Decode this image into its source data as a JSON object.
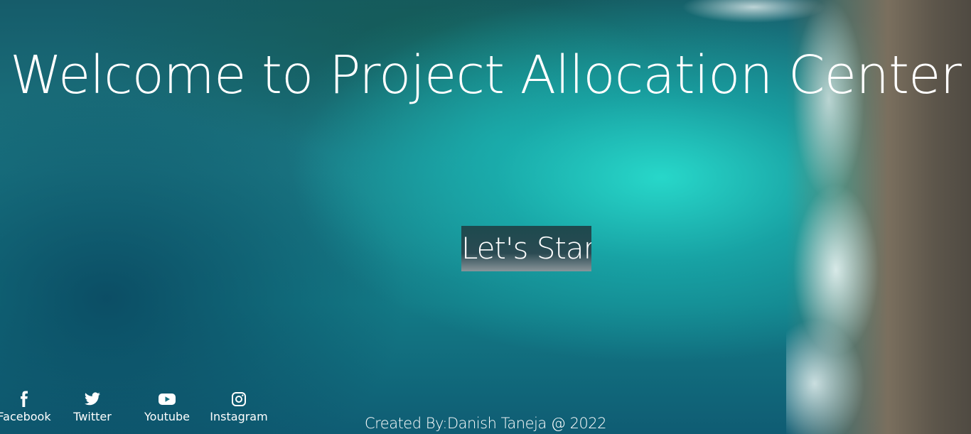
{
  "page": {
    "title": "Welcome to Project Allocation Center",
    "start_button": "Let's Start",
    "footer": "Created By:Danish Taneja @ 2022"
  },
  "social": [
    {
      "label": "Facebook",
      "icon": "facebook-icon"
    },
    {
      "label": "Twitter",
      "icon": "twitter-icon"
    },
    {
      "label": "Youtube",
      "icon": "youtube-icon"
    },
    {
      "label": "Instagram",
      "icon": "instagram-icon"
    }
  ],
  "colors": {
    "text": "#ffffff",
    "button_top": "#1d4a4e",
    "button_bottom": "#8a959a",
    "water": "#1a7783"
  }
}
